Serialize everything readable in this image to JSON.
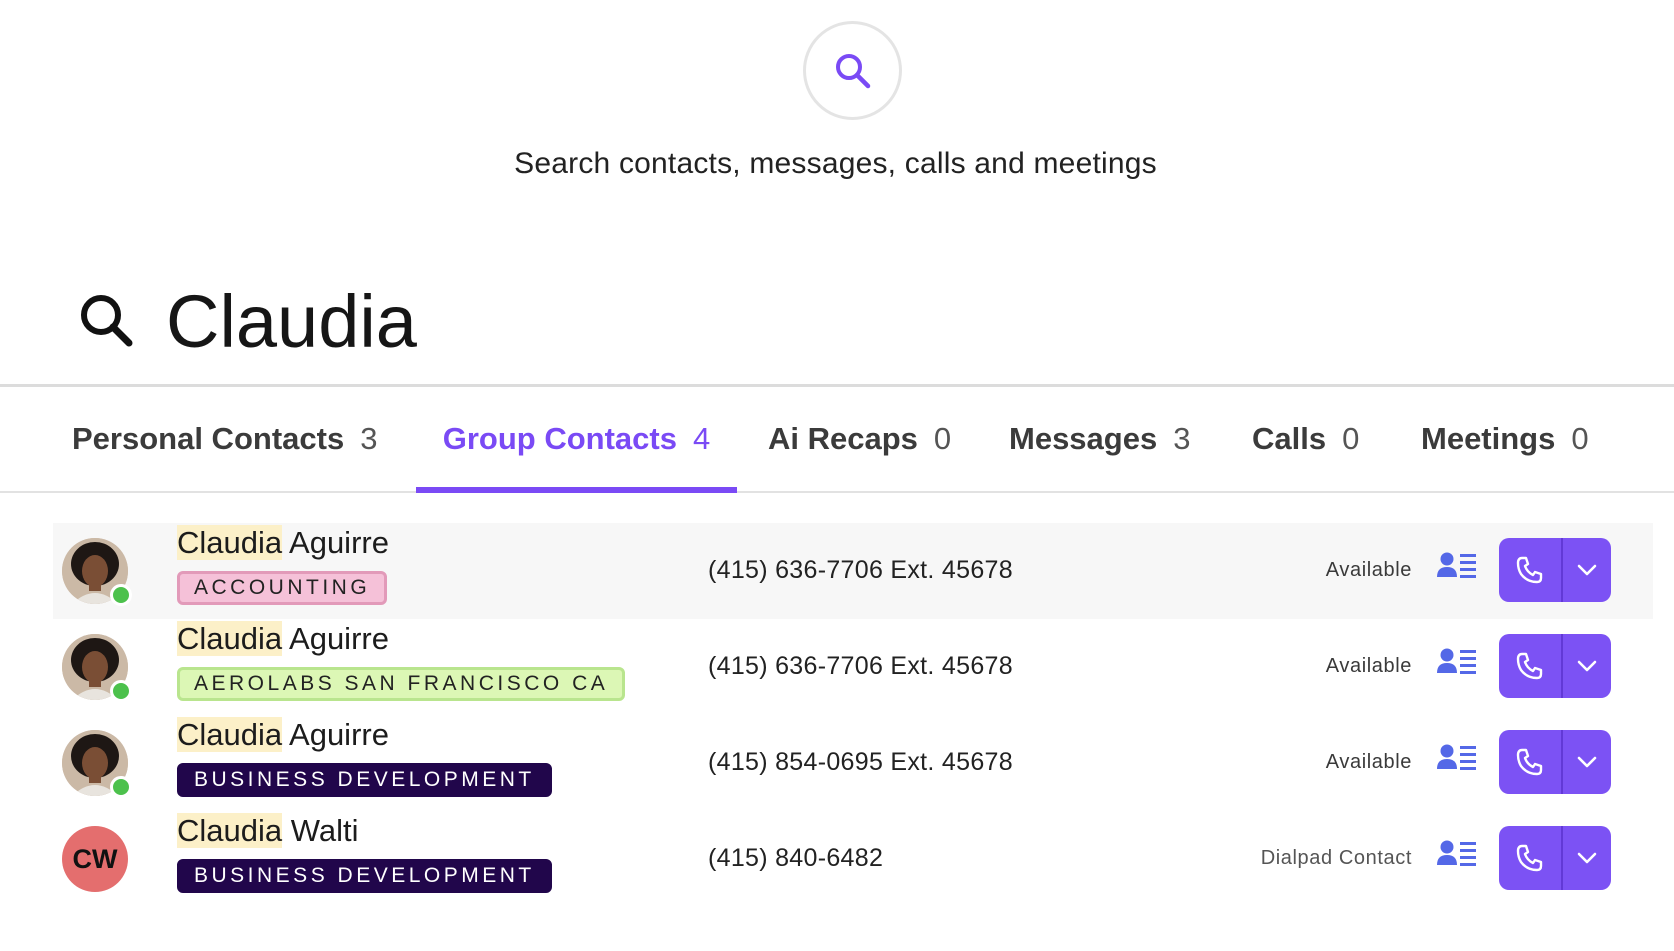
{
  "hint": {
    "icon": "search-icon",
    "text": "Search contacts, messages, calls and meetings"
  },
  "search": {
    "icon": "search-icon",
    "value": "Claudia"
  },
  "tabs": [
    {
      "label": "Personal Contacts",
      "count": "3",
      "active": false
    },
    {
      "label": "Group Contacts",
      "count": "4",
      "active": true
    },
    {
      "label": "Ai Recaps",
      "count": "0",
      "active": false
    },
    {
      "label": "Messages",
      "count": "3",
      "active": false
    },
    {
      "label": "Calls",
      "count": "0",
      "active": false
    },
    {
      "label": "Meetings",
      "count": "0",
      "active": false
    }
  ],
  "results": [
    {
      "name_match": "Claudia",
      "name_rest": " Aguirre",
      "badge": "ACCOUNTING",
      "phone": "(415) 636-7706 Ext. 45678",
      "status": "Available",
      "online": true,
      "avatar": "photo"
    },
    {
      "name_match": "Claudia",
      "name_rest": " Aguirre",
      "badge": "AEROLABS SAN FRANCISCO CA",
      "phone": "(415) 636-7706 Ext. 45678",
      "status": "Available",
      "online": true,
      "avatar": "photo"
    },
    {
      "name_match": "Claudia",
      "name_rest": " Aguirre",
      "badge": "BUSINESS DEVELOPMENT",
      "phone": "(415) 854-0695 Ext. 45678",
      "status": "Available",
      "online": true,
      "avatar": "photo"
    },
    {
      "name_match": "Claudia",
      "name_rest": " Walti",
      "badge": "BUSINESS DEVELOPMENT",
      "phone": "(415) 840-6482",
      "status": "Dialpad Contact",
      "online": false,
      "avatar": "initials",
      "initials": "CW"
    }
  ],
  "colors": {
    "accent": "#7c52f4",
    "match_highlight": "#fcf0c8",
    "presence_online": "#4cc14c",
    "badge_accounting": "#f5c1d8",
    "badge_aerolabs": "#dcf7b5",
    "badge_bizdev": "#21064b",
    "initials_avatar": "#e46e6e"
  },
  "icons": {
    "contact_card": "contact-card-icon",
    "call": "phone-icon",
    "dropdown": "chevron-down-icon"
  }
}
